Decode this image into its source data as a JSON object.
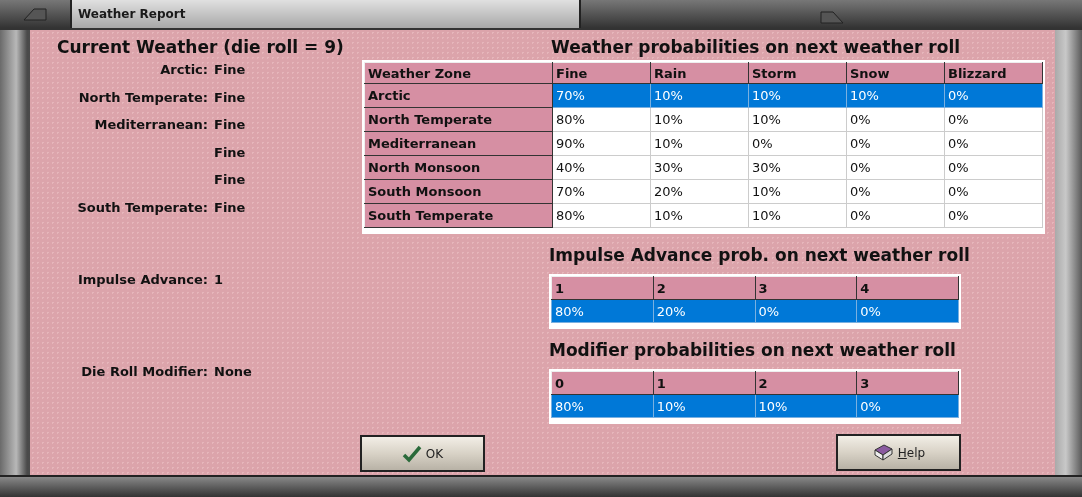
{
  "window": {
    "title": "Weather Report"
  },
  "current_weather": {
    "heading": "Current Weather (die roll = 9)",
    "zones": [
      {
        "label": "Arctic:",
        "value": "Fine"
      },
      {
        "label": "North Temperate:",
        "value": "Fine"
      },
      {
        "label": "Mediterranean:",
        "value": "Fine"
      },
      {
        "value": "Fine"
      },
      {
        "value": "Fine"
      },
      {
        "label": "South Temperate:",
        "value": "Fine"
      }
    ]
  },
  "impulse_advance": {
    "label": "Impulse Advance:",
    "value": "1"
  },
  "die_roll_modifier": {
    "label": "Die Roll Modifier:",
    "value": "None"
  },
  "weather_table": {
    "heading": "Weather probabilities on next weather roll",
    "columns": [
      "Weather Zone",
      "Fine",
      "Rain",
      "Storm",
      "Snow",
      "Blizzard"
    ],
    "rows": [
      {
        "selected": true,
        "cells": [
          "Arctic",
          "70%",
          "10%",
          "10%",
          "10%",
          "0%"
        ]
      },
      {
        "selected": false,
        "cells": [
          "North Temperate",
          "80%",
          "10%",
          "10%",
          "0%",
          "0%"
        ]
      },
      {
        "selected": false,
        "cells": [
          "Mediterranean",
          "90%",
          "10%",
          "0%",
          "0%",
          "0%"
        ]
      },
      {
        "selected": false,
        "cells": [
          "North Monsoon",
          "40%",
          "30%",
          "30%",
          "0%",
          "0%"
        ]
      },
      {
        "selected": false,
        "cells": [
          "South Monsoon",
          "70%",
          "20%",
          "10%",
          "0%",
          "0%"
        ]
      },
      {
        "selected": false,
        "cells": [
          "South Temperate",
          "80%",
          "10%",
          "10%",
          "0%",
          "0%"
        ]
      }
    ]
  },
  "impulse_table": {
    "heading": "Impulse Advance prob. on next weather roll",
    "columns": [
      "1",
      "2",
      "3",
      "4"
    ],
    "rows": [
      {
        "selected": true,
        "cells": [
          "80%",
          "20%",
          "0%",
          "0%"
        ]
      }
    ]
  },
  "modifier_table": {
    "heading": "Modifier probabilities on next weather roll",
    "columns": [
      "0",
      "1",
      "2",
      "3"
    ],
    "rows": [
      {
        "selected": true,
        "cells": [
          "80%",
          "10%",
          "10%",
          "0%"
        ]
      }
    ]
  },
  "buttons": [
    {
      "kind": "ok",
      "label": "OK"
    },
    {
      "kind": "help",
      "label": "Help"
    }
  ]
}
